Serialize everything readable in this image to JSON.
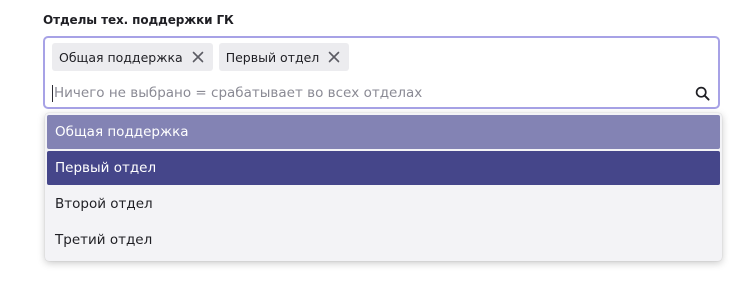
{
  "field": {
    "label": "Отделы тех. поддержки ГК"
  },
  "chips": [
    {
      "label": "Общая поддержка"
    },
    {
      "label": "Первый отдел"
    }
  ],
  "search": {
    "value": "",
    "placeholder": "Ничего не выбрано = срабатывает во всех отделах"
  },
  "options": [
    {
      "label": "Общая поддержка",
      "state": "selected"
    },
    {
      "label": "Первый отдел",
      "state": "selected-highlighted"
    },
    {
      "label": "Второй отдел",
      "state": "normal"
    },
    {
      "label": "Третий отдел",
      "state": "normal"
    }
  ],
  "colors": {
    "focus_border": "#a7a2e6",
    "chip_bg": "#ececef",
    "option_selected_bg": "#8383b4",
    "option_highlighted_bg": "#45468a",
    "dropdown_bg": "#f3f3f6"
  },
  "icons": {
    "chip_remove": "close-icon",
    "search": "search-icon"
  }
}
